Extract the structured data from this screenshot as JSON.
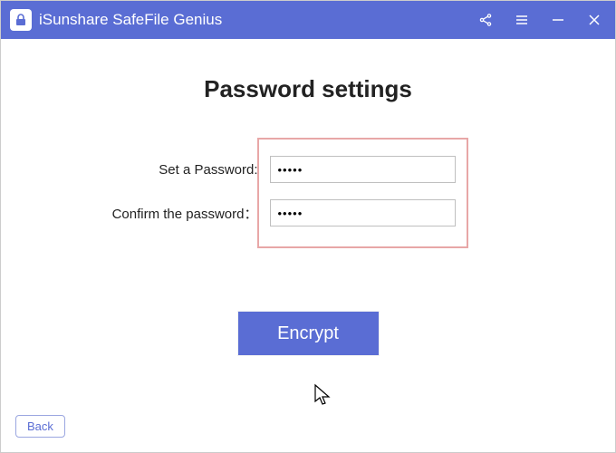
{
  "app": {
    "title": "iSunshare SafeFile Genius"
  },
  "page": {
    "heading": "Password settings",
    "set_password_label": "Set a Password:",
    "confirm_password_label": "Confirm the password：",
    "password_value": "•••••",
    "confirm_value": "•••••",
    "encrypt_label": "Encrypt",
    "back_label": "Back"
  }
}
